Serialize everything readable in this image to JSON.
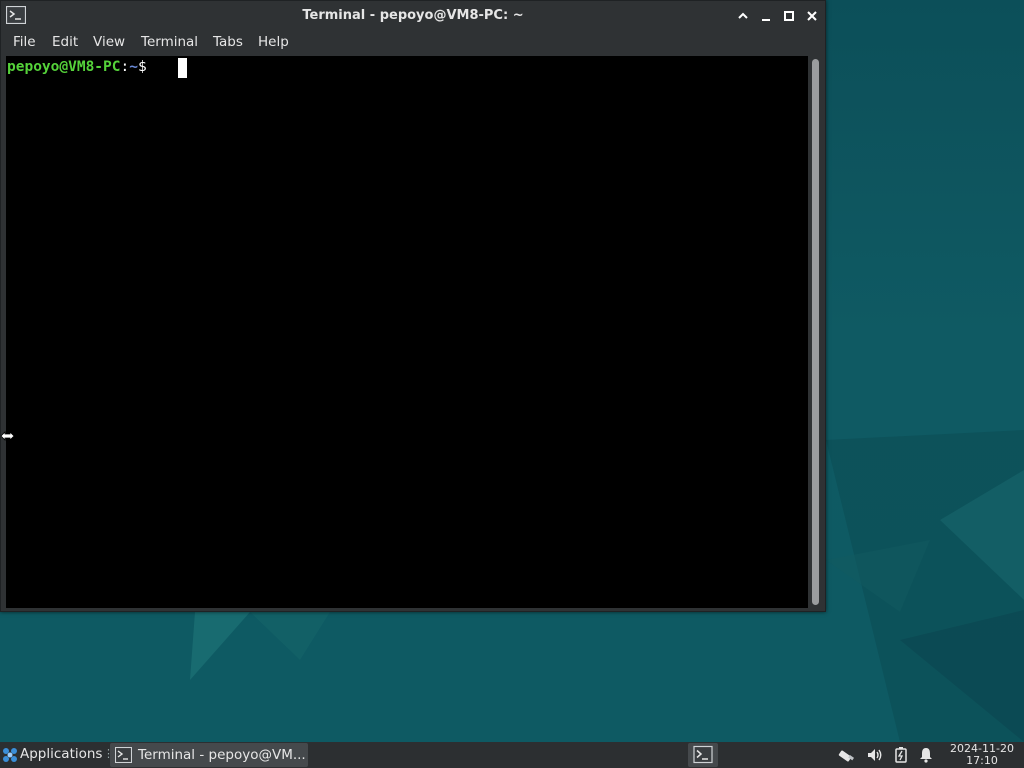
{
  "window": {
    "title": "Terminal - pepoyo@VM8-PC: ~",
    "menu": [
      "File",
      "Edit",
      "View",
      "Terminal",
      "Tabs",
      "Help"
    ]
  },
  "terminal": {
    "prompt_user": "pepoyo@VM8-PC",
    "prompt_colon": ":",
    "prompt_path": "~",
    "prompt_symbol": "$"
  },
  "taskbar": {
    "applications_label": "Applications",
    "task_label": "Terminal - pepoyo@VM...",
    "clock_date": "2024-11-20",
    "clock_time": "17:10"
  },
  "icons": {
    "app_icon": "terminal-icon",
    "window_controls": [
      "chevron-up-icon",
      "minimize-icon",
      "maximize-icon",
      "close-icon"
    ],
    "tray": [
      "network-icon",
      "volume-icon",
      "battery-icon",
      "bell-icon"
    ]
  },
  "colors": {
    "prompt_user": "#55d23a",
    "prompt_path": "#6a8ad8",
    "terminal_bg": "#000000",
    "window_chrome": "#2f3234",
    "desktop": "#0f5660"
  }
}
